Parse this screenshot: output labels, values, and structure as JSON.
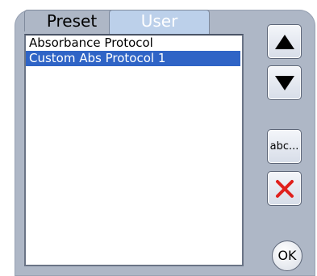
{
  "tabs": [
    {
      "label": "Preset"
    },
    {
      "label": "User"
    }
  ],
  "list": {
    "items": [
      {
        "label": "Absorbance Protocol",
        "selected": false
      },
      {
        "label": "Custom Abs Protocol 1",
        "selected": true
      }
    ]
  },
  "buttons": {
    "up_icon": "up-triangle-icon",
    "down_icon": "down-triangle-icon",
    "rename_label": "abc...",
    "delete_icon": "red-x-icon",
    "ok_label": "OK"
  },
  "colors": {
    "selection": "#2f64c6",
    "delete_icon": "#e0201c",
    "active_tab_text": "#ffffff"
  }
}
